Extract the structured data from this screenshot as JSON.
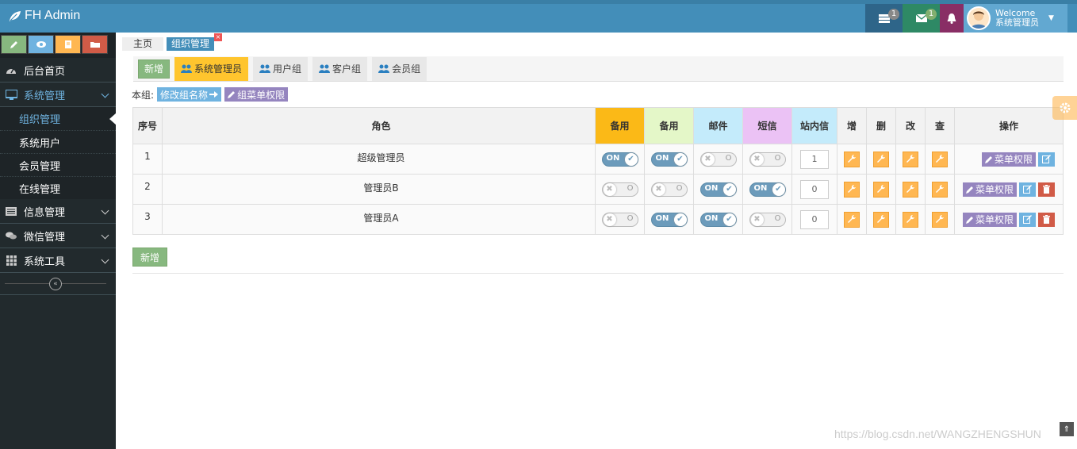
{
  "brand": {
    "title": "FH Admin"
  },
  "navbar": {
    "tasks_badge": "1",
    "messages_badge": "1",
    "user_welcome": "Welcome",
    "user_name": "系统管理员"
  },
  "sidebar": {
    "items": [
      {
        "label": "后台首页"
      },
      {
        "label": "系统管理"
      },
      {
        "label": "信息管理"
      },
      {
        "label": "微信管理"
      },
      {
        "label": "系统工具"
      }
    ],
    "submenu": [
      {
        "label": "组织管理"
      },
      {
        "label": "系统用户"
      },
      {
        "label": "会员管理"
      },
      {
        "label": "在线管理"
      }
    ]
  },
  "breadcrumb": {
    "home": "主页",
    "current": "组织管理"
  },
  "group_tabs": {
    "new_label": "新增",
    "tabs": [
      {
        "label": "系统管理员"
      },
      {
        "label": "用户组"
      },
      {
        "label": "客户组"
      },
      {
        "label": "会员组"
      }
    ]
  },
  "group_ops": {
    "prefix": "本组:",
    "rename": "修改组名称",
    "menu_perm": "组菜单权限"
  },
  "table": {
    "headers": {
      "seq": "序号",
      "role": "角色",
      "b1": "备用",
      "b2": "备用",
      "mail": "邮件",
      "sms": "短信",
      "zn": "站内信",
      "add": "增",
      "del": "删",
      "edit": "改",
      "query": "查",
      "actions": "操作"
    },
    "rows": [
      {
        "seq": "1",
        "role": "超级管理员",
        "b1": "ON",
        "b2": "ON",
        "mail": "O",
        "sms": "O",
        "zn": "1",
        "menu_btn": "菜单权限"
      },
      {
        "seq": "2",
        "role": "管理员B",
        "b1": "O",
        "b2": "O",
        "mail": "ON",
        "sms": "ON",
        "zn": "0",
        "menu_btn": "菜单权限"
      },
      {
        "seq": "3",
        "role": "管理员A",
        "b1": "O",
        "b2": "ON",
        "mail": "ON",
        "sms": "O",
        "zn": "0",
        "menu_btn": "菜单权限"
      }
    ]
  },
  "bottom": {
    "new_label": "新增"
  },
  "watermark": "https://blog.csdn.net/WANGZHENGSHUN",
  "colors": {
    "navbar": "#438eb9",
    "sidebar": "#222a2d",
    "accent_yellow": "#ffc52e",
    "green": "#87b87f",
    "purple": "#9585bf",
    "blue": "#6fb3e0",
    "red": "#d15b47"
  }
}
